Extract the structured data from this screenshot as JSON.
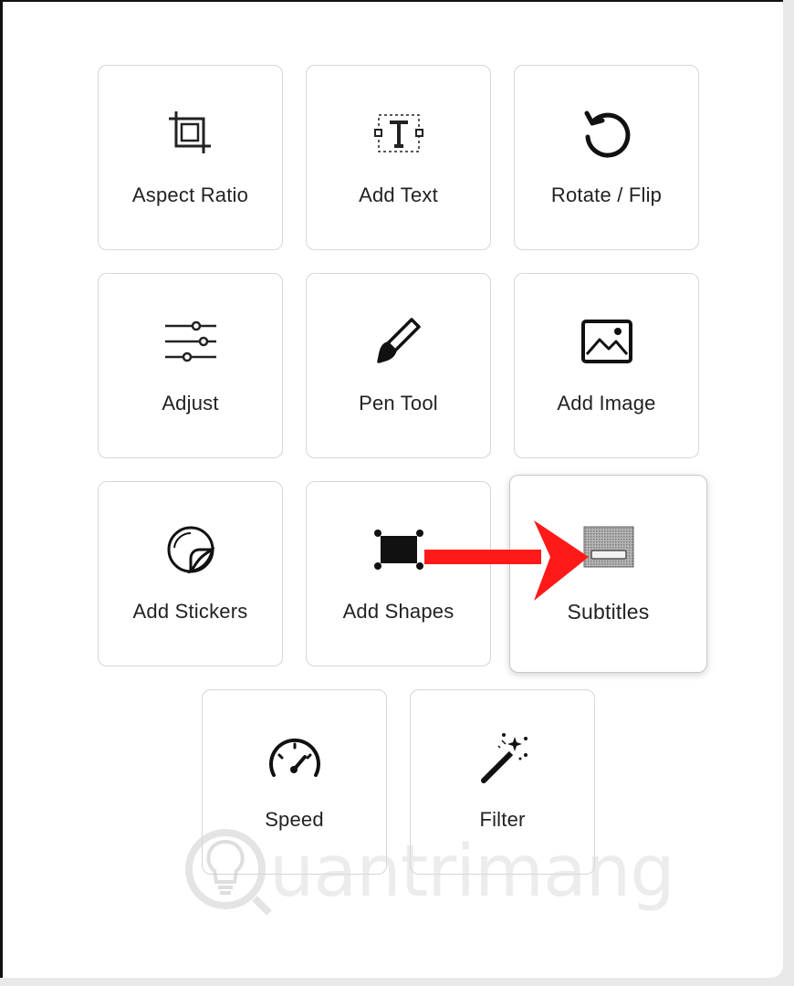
{
  "tools": [
    {
      "label": "Aspect Ratio",
      "icon": "crop-icon"
    },
    {
      "label": "Add Text",
      "icon": "text-box-icon"
    },
    {
      "label": "Rotate / Flip",
      "icon": "rotate-icon"
    },
    {
      "label": "Adjust",
      "icon": "sliders-icon"
    },
    {
      "label": "Pen Tool",
      "icon": "brush-icon"
    },
    {
      "label": "Add Image",
      "icon": "image-icon"
    },
    {
      "label": "Add Stickers",
      "icon": "sticker-icon"
    },
    {
      "label": "Add Shapes",
      "icon": "rectangle-shape-icon"
    },
    {
      "label": "Subtitles",
      "icon": "subtitles-icon"
    },
    {
      "label": "Speed",
      "icon": "speedometer-icon"
    },
    {
      "label": "Filter",
      "icon": "magic-wand-icon"
    }
  ],
  "highlight": {
    "target": "Subtitles",
    "arrow_color": "#ff1a1a"
  },
  "watermark": {
    "text": "uantrimang"
  }
}
